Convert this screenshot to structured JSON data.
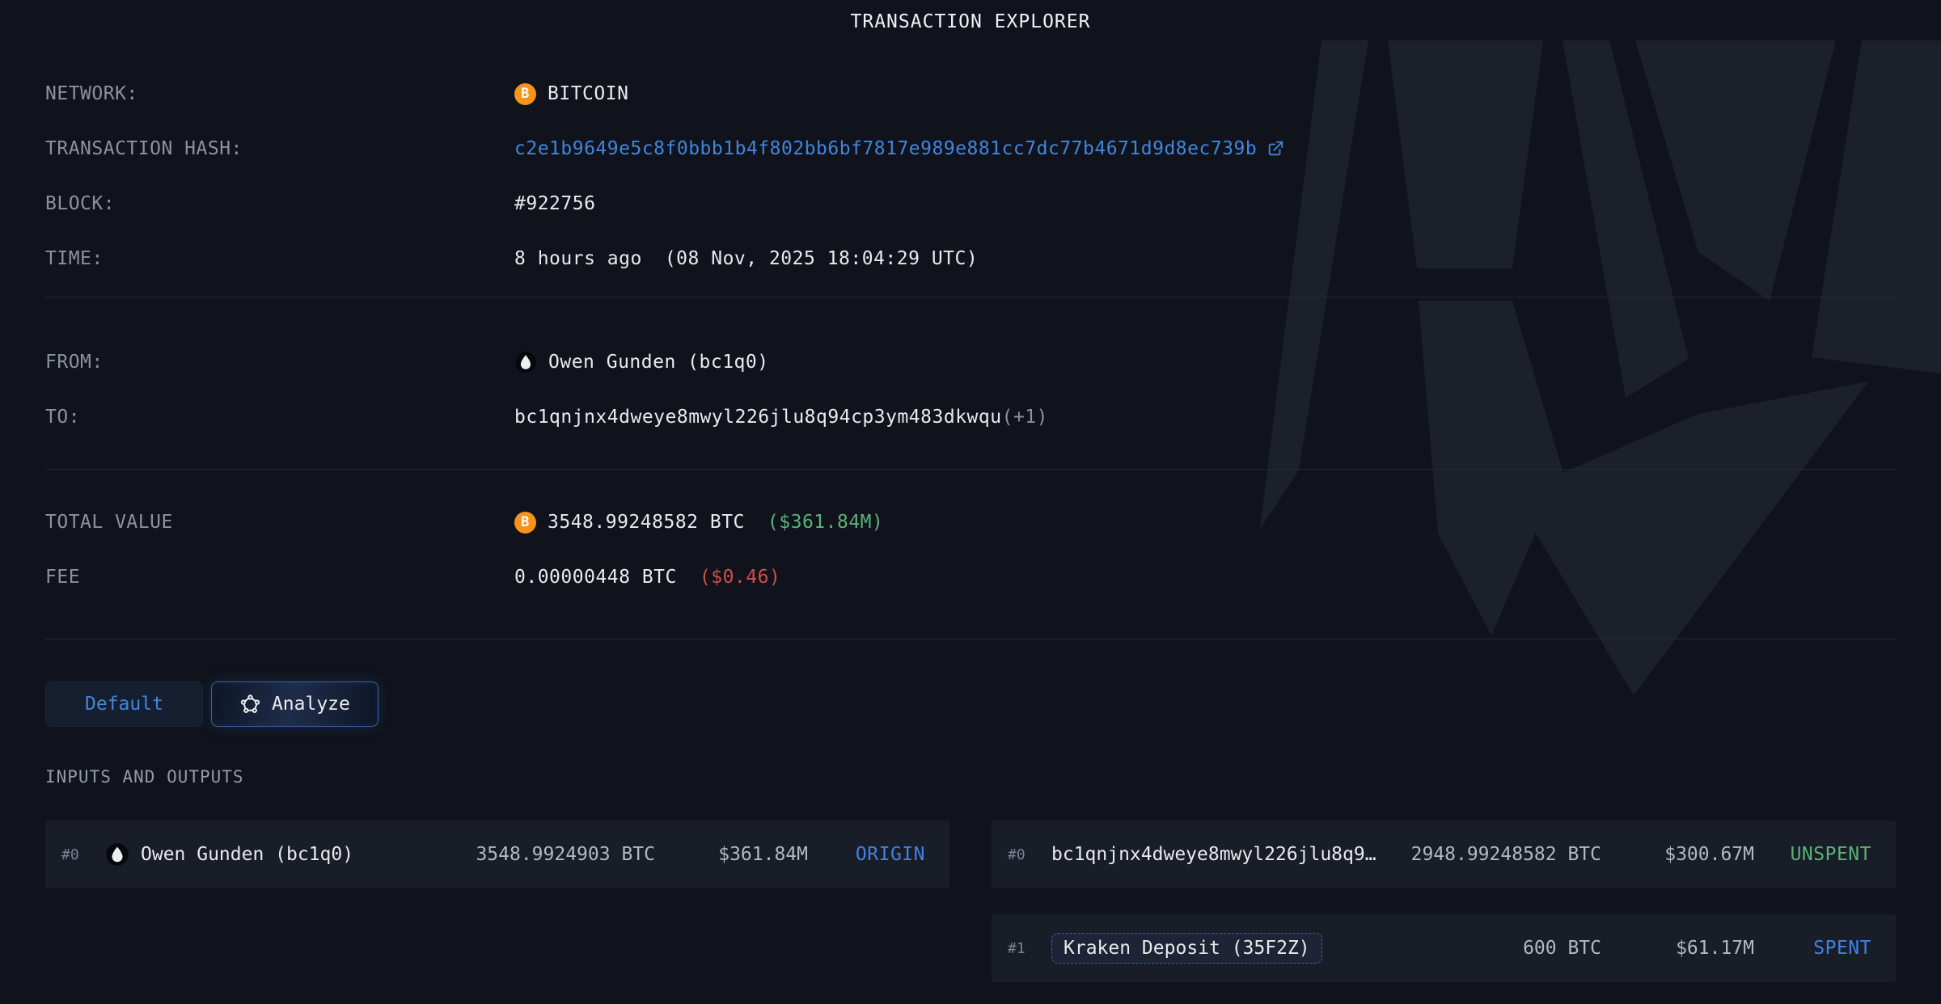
{
  "header": {
    "title": "TRANSACTION EXPLORER"
  },
  "icons": {
    "bitcoin_symbol": "B"
  },
  "colors": {
    "accent_blue": "#4285dd",
    "status_blue": "#3f82e6",
    "positive_green": "#5cb176",
    "negative_red": "#cf4f4a",
    "bitcoin_orange": "#f7931a"
  },
  "details": {
    "network": {
      "label": "NETWORK:",
      "value": "BITCOIN"
    },
    "hash": {
      "label": "TRANSACTION HASH:",
      "value": "c2e1b9649e5c8f0bbb1b4f802bb6bf7817e989e881cc7dc77b4671d9d8ec739b"
    },
    "block": {
      "label": "BLOCK:",
      "value": "#922756"
    },
    "time": {
      "label": "TIME:",
      "relative": "8 hours ago",
      "absolute": "(08 Nov, 2025 18:04:29 UTC)"
    },
    "from": {
      "label": "FROM:",
      "value": "Owen Gunden (bc1q0)"
    },
    "to": {
      "label": "TO:",
      "value": "bc1qnjnx4dweye8mwyl226jlu8q94cp3ym483dkwqu",
      "extra": "(+1)"
    },
    "total": {
      "label": "TOTAL VALUE",
      "btc": "3548.99248582 BTC",
      "usd": "($361.84M)"
    },
    "fee": {
      "label": "FEE",
      "btc": "0.00000448 BTC",
      "usd": "($0.46)"
    }
  },
  "tabs": {
    "default_label": "Default",
    "analyze_label": "Analyze"
  },
  "io": {
    "section_title": "INPUTS AND OUTPUTS",
    "inputs": [
      {
        "index": "#0",
        "icon": "droplet-avatar",
        "name": "Owen Gunden (bc1q0)",
        "btc": "3548.9924903 BTC",
        "usd": "$361.84M",
        "status": "ORIGIN",
        "status_color": "status_blue",
        "tagged": false
      }
    ],
    "outputs": [
      {
        "index": "#0",
        "icon": null,
        "name": "bc1qnjnx4dweye8mwyl226jlu8q9…",
        "btc": "2948.99248582 BTC",
        "usd": "$300.67M",
        "status": "UNSPENT",
        "status_color": "positive_green",
        "tagged": false
      },
      {
        "index": "#1",
        "icon": null,
        "name": "Kraken Deposit (35F2Z)",
        "btc": "600 BTC",
        "usd": "$61.17M",
        "status": "SPENT",
        "status_color": "status_blue",
        "tagged": true
      }
    ]
  }
}
